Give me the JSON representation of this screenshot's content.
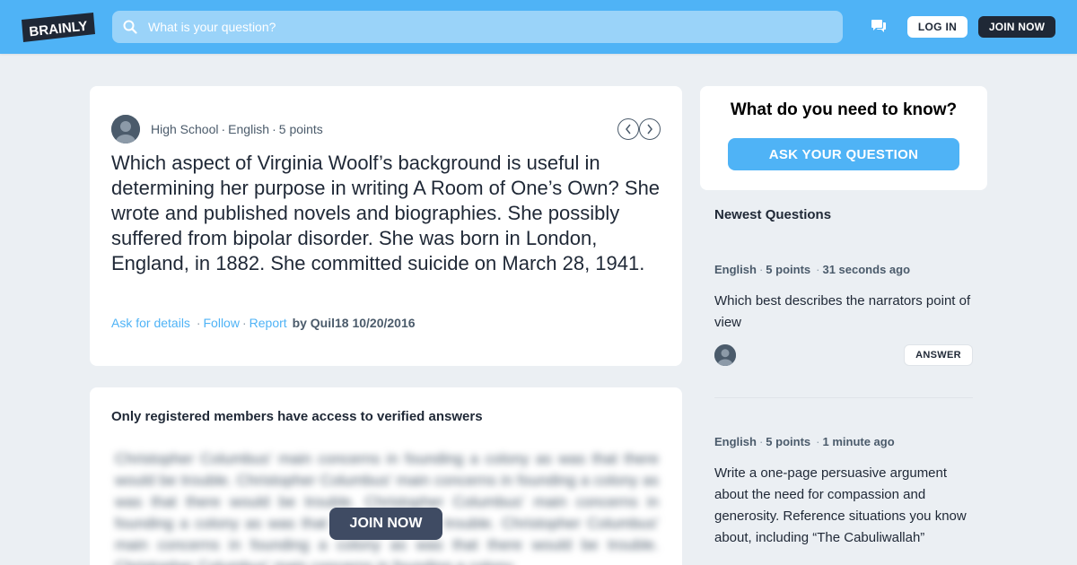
{
  "header": {
    "logo_text": "BRAINLY",
    "search_placeholder": "What is your question?",
    "login_label": "LOG IN",
    "join_label": "JOIN NOW"
  },
  "question": {
    "level": "High School",
    "subject": "English",
    "points": "5 points",
    "text": "Which aspect of Virginia Woolf’s background is useful in determining her purpose in writing A Room of One’s Own? She wrote and published novels and biographies. She possibly suffered from bipolar disorder. She was born in London, England, in 1882. She committed suicide on March 28, 1941.",
    "ask_details": "Ask for details",
    "follow": "Follow",
    "report": "Report",
    "byline": "by Quil18 10/20/2016"
  },
  "answers": {
    "title": "Only registered members have access to verified answers",
    "blurred_text": "Christopher Columbus' main concerns in founding a colony as was that there would be trouble. Christopher Columbus' main concerns in founding a colony as was that there would be trouble. Christopher Columbus' main concerns in founding a colony as was that there would be trouble. Christopher Columbus' main concerns in founding a colony as was that there would be trouble. Christopher Columbus' main concerns in founding a colony.",
    "join_label": "JOIN NOW"
  },
  "ask": {
    "heading": "What do you need to know?",
    "button": "ASK YOUR QUESTION"
  },
  "newest": {
    "title": "Newest Questions",
    "items": [
      {
        "subject": "English",
        "points": "5 points",
        "time": "31 seconds ago",
        "text": "Which best describes the narrators point of view",
        "answer_label": "ANSWER"
      },
      {
        "subject": "English",
        "points": "5 points",
        "time": "1 minute ago",
        "text": "Write a one-page persuasive argument about the need for compassion and generosity. Reference situations you know about, including “The Cabuliwallah”"
      }
    ]
  },
  "colors": {
    "header_blue": "#4fb3f6",
    "dark_navy": "#1f2836",
    "link_blue": "#4fb3f6",
    "page_bg": "#ebeff3"
  },
  "icons": [
    "search-icon",
    "chat-icon",
    "user-avatar-icon",
    "chevron-left-icon",
    "chevron-right-icon"
  ]
}
